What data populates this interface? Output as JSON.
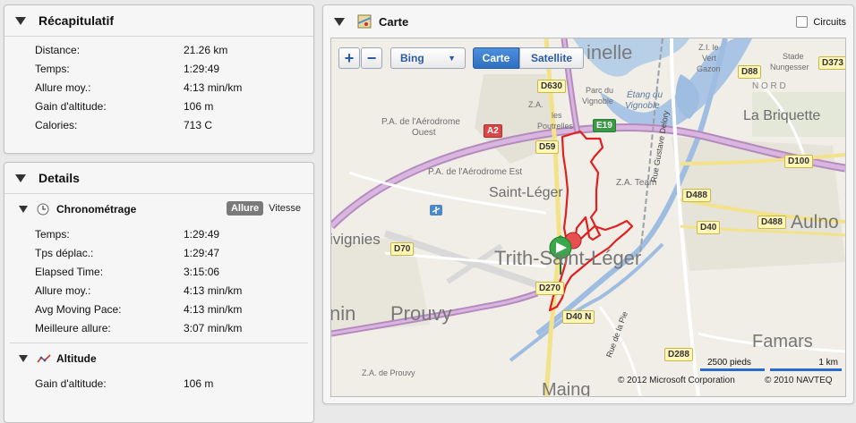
{
  "summary": {
    "title": "Récapitulatif",
    "rows": [
      {
        "label": "Distance:",
        "value": "21.26 km"
      },
      {
        "label": "Temps:",
        "value": "1:29:49"
      },
      {
        "label": "Allure moy.:",
        "value": "4:13 min/km"
      },
      {
        "label": "Gain d'altitude:",
        "value": "106 m"
      },
      {
        "label": "Calories:",
        "value": "713 C"
      }
    ]
  },
  "details": {
    "title": "Details",
    "timing": {
      "title": "Chronométrage",
      "toggle": {
        "active": "Allure",
        "inactive": "Vitesse"
      },
      "rows": [
        {
          "label": "Temps:",
          "value": "1:29:49"
        },
        {
          "label": "Tps déplac.:",
          "value": "1:29:47"
        },
        {
          "label": "Elapsed Time:",
          "value": "3:15:06"
        },
        {
          "label": "Allure moy.:",
          "value": "4:13 min/km"
        },
        {
          "label": "Avg Moving Pace:",
          "value": "4:13 min/km"
        },
        {
          "label": "Meilleure allure:",
          "value": "3:07 min/km"
        }
      ]
    },
    "altitude": {
      "title": "Altitude",
      "rows": [
        {
          "label": "Gain d'altitude:",
          "value": "106 m"
        }
      ]
    }
  },
  "map": {
    "title": "Carte",
    "circuits_label": "Circuits",
    "zoom_in": "+",
    "zoom_out": "−",
    "provider": "Bing",
    "view_carte": "Carte",
    "view_satellite": "Satellite",
    "scale_imperial": "2500 pieds",
    "scale_metric": "1 km",
    "copyright_ms": "© 2012 Microsoft Corporation",
    "copyright_navteq": "© 2010 NAVTEQ",
    "places": {
      "saint_leger": "Saint-Léger",
      "trith": "Trith-Saint-Léger",
      "prouvy": "Prouvy",
      "la_briquette": "La Briquette",
      "aulno": "Aulno",
      "famars": "Famars",
      "maing": "Maing",
      "vignies": "ivignies",
      "nin": "nin",
      "nelle": "inelle",
      "aerodrome_ouest_1": "P.A. de l'Aérodrome",
      "aerodrome_ouest_2": "Ouest",
      "aerodrome_est": "P.A. de l'Aérodrome Est",
      "les_poutrelles_1": "Z.A.",
      "les_poutrelles_2": "les",
      "les_poutrelles_3": "Poutrelles",
      "parc_vignoble_1": "Parc du",
      "parc_vignoble_2": "Vignoble",
      "etang_1": "Étang du",
      "etang_2": "Vignoble",
      "za_team": "Z.A. Team",
      "zi_vert_1": "Z.I. le",
      "zi_vert_2": "Vert",
      "zi_vert_3": "Gazon",
      "stade_1": "Stade",
      "stade_2": "Nungesser",
      "nord": "N O R D",
      "za_prouvy": "Z.A. de Prouvy",
      "rue_gustave": "Rue Gustave Delory",
      "rue_pie": "Rue de la Pie"
    },
    "roads": {
      "d630": "D630",
      "a2": "A2",
      "e19": "E19",
      "d59": "D59",
      "d88": "D88",
      "d373": "D373",
      "d100": "D100",
      "d488a": "D488",
      "d488b": "D488",
      "d40": "D40",
      "d70": "D70",
      "d270": "D270",
      "d40n": "D40 N",
      "d288": "D288"
    }
  }
}
